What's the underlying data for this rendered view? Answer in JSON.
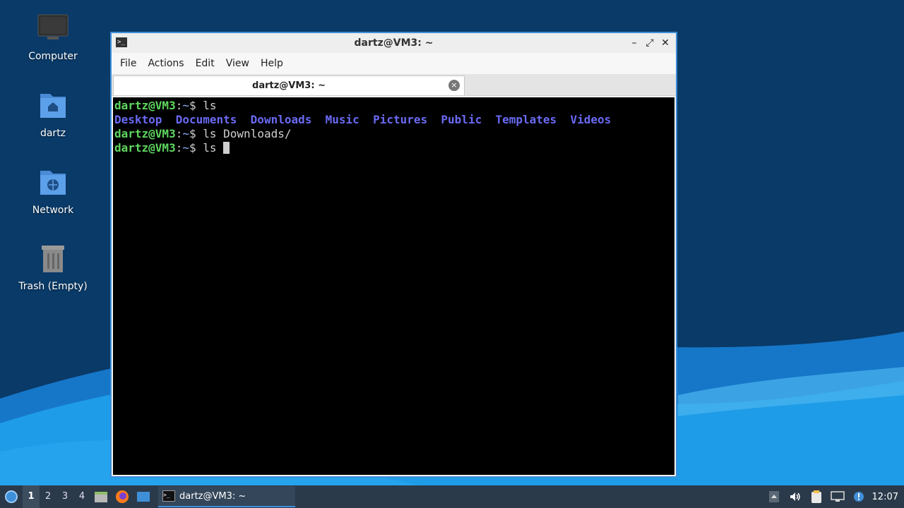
{
  "desktop": {
    "icons": [
      {
        "label": "Computer",
        "icon": "computer-icon"
      },
      {
        "label": "dartz",
        "icon": "home-folder-icon"
      },
      {
        "label": "Network",
        "icon": "network-folder-icon"
      },
      {
        "label": "Trash (Empty)",
        "icon": "trash-icon"
      }
    ]
  },
  "window": {
    "title": "dartz@VM3: ~",
    "buttons": {
      "minimize": "–",
      "maximize": "⤢",
      "close": "✕"
    },
    "menu": [
      "File",
      "Actions",
      "Edit",
      "View",
      "Help"
    ],
    "tab": {
      "title": "dartz@VM3: ~",
      "close": "×"
    }
  },
  "terminal": {
    "prompt_user": "dartz@VM3",
    "prompt_sep": ":",
    "prompt_path": "~",
    "prompt_symbol": "$ ",
    "lines": [
      {
        "type": "cmd",
        "text": "ls"
      },
      {
        "type": "dirs",
        "items": [
          "Desktop",
          "Documents",
          "Downloads",
          "Music",
          "Pictures",
          "Public",
          "Templates",
          "Videos"
        ]
      },
      {
        "type": "cmd",
        "text": "ls Downloads/"
      },
      {
        "type": "cmd",
        "text": "ls "
      }
    ]
  },
  "taskbar": {
    "workspaces": [
      "1",
      "2",
      "3",
      "4"
    ],
    "active_workspace": "1",
    "launchers": [
      "file-manager-icon",
      "firefox-icon",
      "show-desktop-icon"
    ],
    "task": {
      "title": "dartz@VM3: ~"
    },
    "tray": [
      "tray-arrow-icon",
      "volume-icon",
      "clipboard-icon",
      "network-status-icon",
      "update-notifier-icon"
    ],
    "clock": "12:07"
  },
  "colors": {
    "accent": "#3f8fd8",
    "wallpaper_dark": "#0a3a68",
    "wallpaper_light": "#1e9ce8",
    "prompt_green": "#5fd75f",
    "dir_blue": "#6a6af4"
  }
}
